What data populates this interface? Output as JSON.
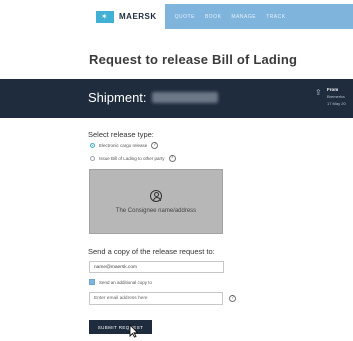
{
  "brand": {
    "name": "MAERSK",
    "accent": "#42b0d5",
    "nav_bg": "#7fb4dd",
    "dark": "#1e2c3e"
  },
  "nav": {
    "items": [
      "QUOTE",
      "BOOK",
      "MANAGE",
      "TRACK"
    ]
  },
  "page": {
    "title": "Request to release Bill of Lading"
  },
  "shipment": {
    "label": "Shipment:",
    "from_label": "From",
    "from_place": "Bremerha",
    "from_date": "17 May 20"
  },
  "release": {
    "label": "Select release type:",
    "options": [
      {
        "label": "Electronic cargo release",
        "selected": true
      },
      {
        "label": "Issue Bill of Lading to other party",
        "selected": false
      }
    ],
    "party_card": {
      "text": "The Consignee name/address",
      "icon": "person-circle-icon"
    }
  },
  "copy": {
    "label": "Send a copy of the release request to:",
    "email_value": "name@maersk.com",
    "additional_checkbox_label": "Send an additional copy to",
    "additional_checked": true,
    "additional_placeholder": "Enter email address here"
  },
  "submit": {
    "label": "SUBMIT REQUEST"
  }
}
